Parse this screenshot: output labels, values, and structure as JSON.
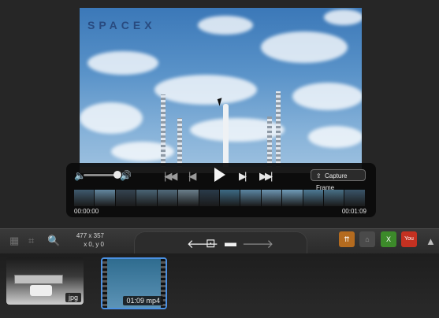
{
  "player": {
    "capture_label": "Capture Frame",
    "time_start": "00:00:00",
    "time_end": "00:01:09",
    "filmstrip_colors": [
      "#3f5a6e",
      "#62879f",
      "#354451",
      "#4a6475",
      "#516a7b",
      "#6a7f8c",
      "#2a3b4a",
      "#3d6a85",
      "#5b86a2",
      "#6c94b0",
      "#6f9bb8",
      "#4d7a95",
      "#486f86",
      "#3a5468"
    ]
  },
  "video": {
    "logo_text": "SPACEX"
  },
  "toolbar": {
    "dimensions": "477 x 357",
    "coordinates": "x 0,  y 0"
  },
  "library": {
    "items": [
      {
        "type_badge": "jpg"
      },
      {
        "duration_badge": "01:09 mp4"
      }
    ]
  }
}
